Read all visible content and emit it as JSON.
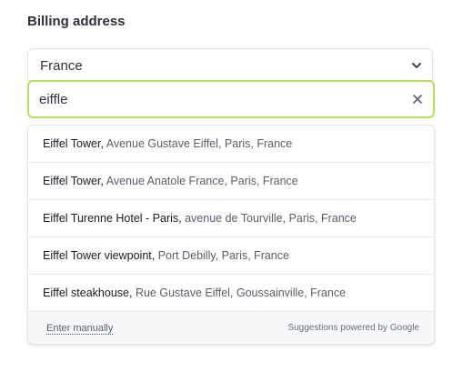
{
  "form": {
    "heading": "Billing address",
    "country_value": "France",
    "search_value": "eiffle"
  },
  "suggestions": [
    {
      "main": "Eiffel Tower",
      "sub": "Avenue Gustave Eiffel, Paris, France"
    },
    {
      "main": "Eiffel Tower",
      "sub": "Avenue Anatole France, Paris, France"
    },
    {
      "main": "Eiffel Turenne Hotel - Paris",
      "sub": "avenue de Tourville, Paris, France"
    },
    {
      "main": "Eiffel Tower viewpoint",
      "sub": "Port Debilly, Paris, France"
    },
    {
      "main": "Eiffel steakhouse",
      "sub": "Rue Gustave Eiffel, Goussainville, France"
    }
  ],
  "footer": {
    "enter_manually": "Enter manually",
    "powered_by": "Suggestions powered by Google"
  },
  "colors": {
    "focus_border": "#b3e05a",
    "text": "#30313d",
    "secondary_text": "#5a5d6b"
  },
  "icons": {
    "country_dropdown": "chevron-down-icon",
    "clear": "close-icon"
  }
}
